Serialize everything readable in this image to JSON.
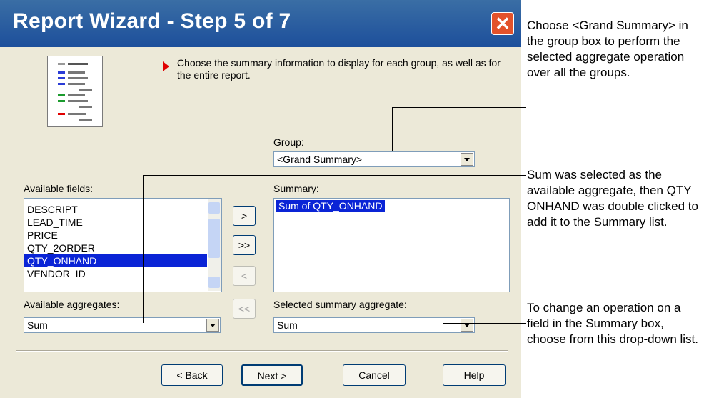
{
  "dialog": {
    "title": "Report Wizard - Step 5 of 7",
    "instruction": "Choose the summary information to display for each group, as well as for the entire report."
  },
  "group": {
    "label": "Group:",
    "value": "<Grand Summary>"
  },
  "available_fields": {
    "label": "Available fields:",
    "items": [
      "DESCRIPT",
      "LEAD_TIME",
      "PRICE",
      "QTY_2ORDER",
      "QTY_ONHAND",
      "VENDOR_ID"
    ],
    "selected": "QTY_ONHAND"
  },
  "summary": {
    "label": "Summary:",
    "items": [
      "Sum of QTY_ONHAND"
    ]
  },
  "move_buttons": {
    "add": ">",
    "add_all": ">>",
    "remove": "<",
    "remove_all": "<<"
  },
  "available_aggregates": {
    "label": "Available aggregates:",
    "value": "Sum"
  },
  "selected_summary_aggregate": {
    "label": "Selected summary aggregate:",
    "value": "Sum"
  },
  "footer": {
    "back": "< Back",
    "next": "Next >",
    "cancel": "Cancel",
    "help": "Help"
  },
  "annotations": {
    "grand_summary": "Choose <Grand Summary> in the group box to perform the selected aggregate operation over all the groups.",
    "sum_selected": "Sum was selected as the available aggregate, then QTY ONHAND was double clicked to add it to the Summary list.",
    "change_operation": "To change an operation on a field in the Summary box, choose from this drop-down list."
  }
}
